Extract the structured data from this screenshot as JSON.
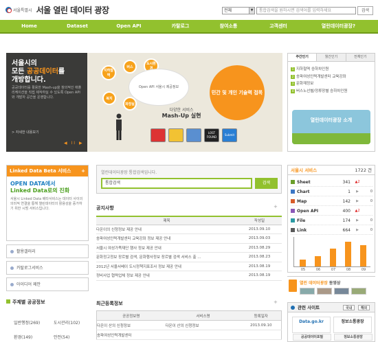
{
  "header": {
    "org": "서울특별시",
    "title": "서울 열린 데이터 광장",
    "search_scope": "전체",
    "search_placeholder": "통합검색을 원하시면 검색어를 입력하세요",
    "search_button": "검색"
  },
  "nav": [
    "Home",
    "Dataset",
    "Open API",
    "카탈로그",
    "참여소통",
    "고객센터",
    "열린데이터광장?"
  ],
  "hero": {
    "title_line1": "서울시의",
    "title_line2_pre": "모든 ",
    "title_line2_hl": "공공데이터",
    "title_line2_post": "를",
    "title_line3": "개방합니다.",
    "desc": "공공데이터를 활용한 Mash-up을 창의적인 애플리케이션을 직접 제작하실 수 있도록 Open API와 개발자 공간을 운영합니다.",
    "more": "> 자세한 내용보기",
    "pager": "◀ II ▶",
    "bubbles": [
      "지하철역",
      "버스",
      "도시환경",
      "문화",
      "복지",
      "화장실"
    ],
    "oval_text": "Open API 서울시 제공정보",
    "orange_text": "민간 및 개인 기술력 접목",
    "mashup_sub": "다양한 서비스",
    "mashup_title": "Mash-Up 실현",
    "tiles": [
      "app1",
      "app2",
      "LOST FOUND",
      "app4",
      "Submit"
    ]
  },
  "hero_tabs": {
    "tabs": [
      "주간인기",
      "월간인기",
      "전체인기"
    ],
    "items": [
      "지하철역 승하차인원",
      "송파여성인력개발센터 교육강좌",
      "문화재정보",
      "버스노선별/정류장별 승하차인원"
    ],
    "intro": "열린데이터광장 소개"
  },
  "linked_data": {
    "head": "Linked Data Beta 서비스",
    "more": "+",
    "title_line1": "OPEN DATA에서",
    "title_line2": "Linked Data로의 진화",
    "desc": "서울시 Linked Data 베타서비스는 데이터 사이의 의미적 연결을 통해 열린데이터의 활용성을 증가하기 위한 시범 서비스입니다."
  },
  "left_links": [
    "활용갤러리",
    "카탈로그서비스",
    "아이디어 제안"
  ],
  "categories": {
    "title": "주제별 공공정보",
    "items": [
      "일반행정(269)",
      "도시관리(102)",
      "환경(149)",
      "안전(54)"
    ]
  },
  "center_search": {
    "label": "열린데이터광장 통합검색입니다.",
    "value": "통합검색",
    "button": "검색"
  },
  "notice": {
    "title": "공지사항",
    "more": "+",
    "col_title": "제목",
    "col_date": "작성일",
    "rows": [
      {
        "title": "다온이의 신청정보 제공 안내",
        "date": "2013.09.10"
      },
      {
        "title": "송파여성인력개발센터 교육강좌 정보 제공 안내",
        "date": "2013.09.03"
      },
      {
        "title": "서울시 여성가족재단 행사 정보 제공 안내",
        "date": "2013.08.29"
      },
      {
        "title": "문화정고정보 장르별 검색, 문화행사정보 장르별 검색 서비스 출 ...",
        "date": "2013.08.23"
      },
      {
        "title": "2012년 서울서베이 도시정책지표조사 정보 제공 안내",
        "date": "2013.08.19"
      },
      {
        "title": "정비사업 협력업체 정보 제공 안내",
        "date": "2013.08.19"
      }
    ]
  },
  "new_services": {
    "title": "최근등록정보",
    "more": "+",
    "cols": [
      "공공정보명",
      "서비스명",
      "등록일자"
    ],
    "rows": [
      {
        "info": "다온이 산의 신청정보",
        "service": "다온이 산의 신청정보",
        "date": "2013.09.10"
      },
      {
        "info": "송파여성인력개발센터",
        "service": "",
        "date": ""
      }
    ]
  },
  "stats": {
    "head": "서울시 서비스",
    "total_label": "1722 건",
    "rows": [
      {
        "name": "Sheet",
        "value": "341",
        "change": "▲2",
        "count": ""
      },
      {
        "name": "Chart",
        "value": "1",
        "change": "▶",
        "count": "0"
      },
      {
        "name": "Map",
        "value": "142",
        "change": "▶",
        "count": "0"
      },
      {
        "name": "Open API",
        "value": "400",
        "change": "▲2",
        "count": ""
      },
      {
        "name": "File",
        "value": "174",
        "change": "▶",
        "count": "0"
      },
      {
        "name": "Link",
        "value": "664",
        "change": "▶",
        "count": "0"
      }
    ],
    "chart_labels": [
      "05",
      "06",
      "07",
      "08",
      "09"
    ],
    "chart_values": [
      2,
      3,
      5,
      7,
      6
    ]
  },
  "video": {
    "title_hl": "열린 데이터광장",
    "title_rest": " 동영상"
  },
  "sites": {
    "title": "관련 사이트",
    "tab_domestic": "국내",
    "tab_foreign": "해외",
    "items": [
      {
        "logo": "Data.go.kr",
        "caption": "공공데이터포털"
      },
      {
        "logo": "정보소통광장",
        "caption": "정보소통광장"
      }
    ]
  },
  "colors": {
    "brand_green": "#92c12e",
    "accent_orange": "#f7941d",
    "link_blue": "#1e7fc1"
  }
}
